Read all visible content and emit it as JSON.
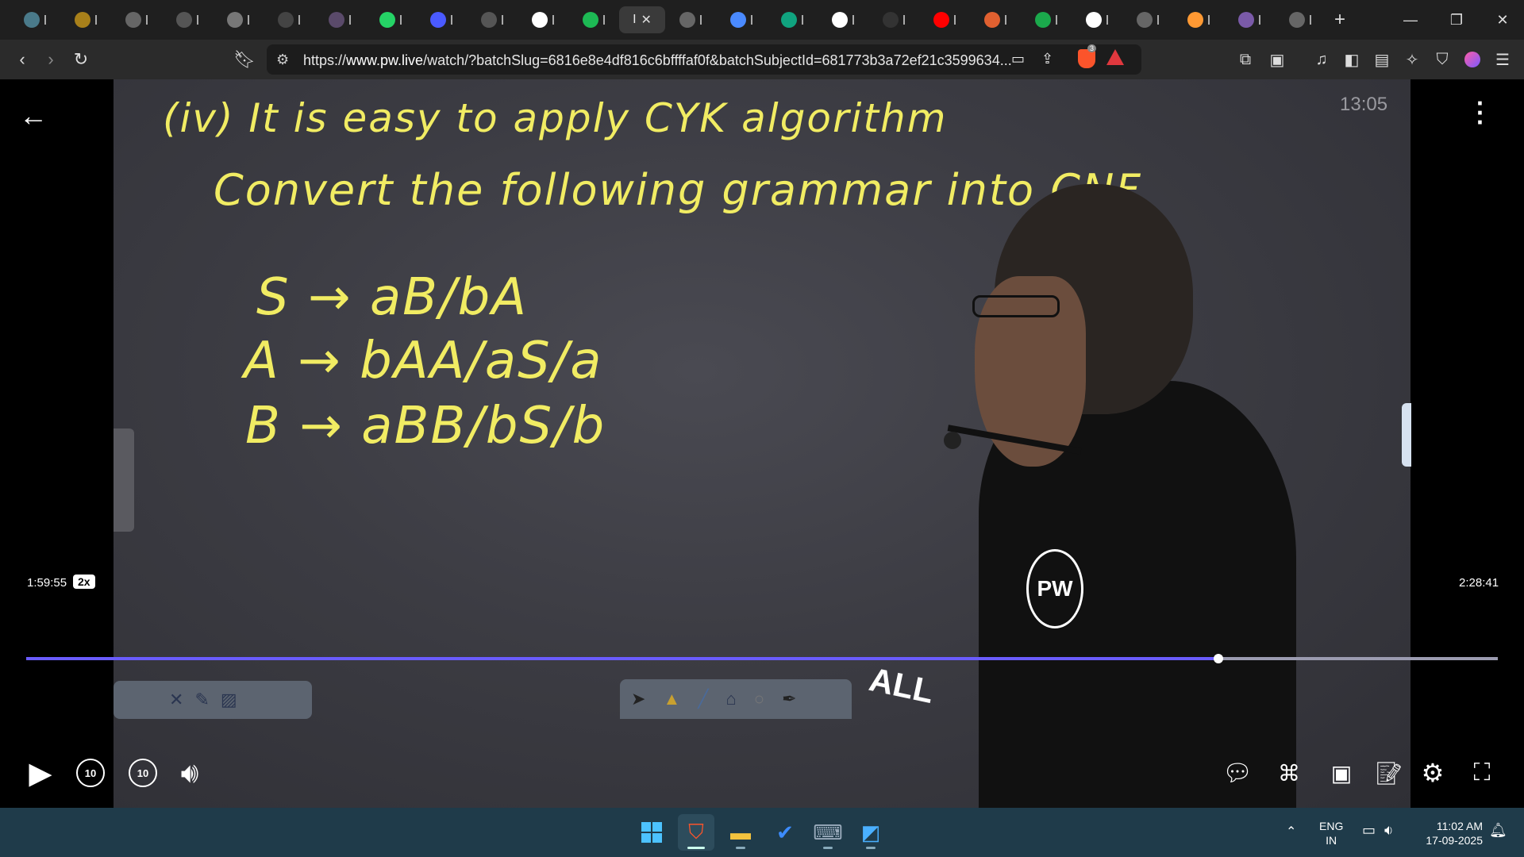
{
  "browser": {
    "tabs": [
      {
        "icon": "chat-icon",
        "color": "#4a7a8a"
      },
      {
        "icon": "coin-icon",
        "color": "#a8801a"
      },
      {
        "icon": "globe-icon",
        "color": "#666"
      },
      {
        "icon": "gpt-icon",
        "color": "#555"
      },
      {
        "icon": "w3-icon",
        "color": "#777"
      },
      {
        "icon": "aoe-icon",
        "color": "#444"
      },
      {
        "icon": "portrait-icon",
        "color": "#5a4a6a"
      },
      {
        "icon": "whatsapp-icon",
        "color": "#25d366"
      },
      {
        "icon": "bookmark-icon",
        "color": "#4a5aff"
      },
      {
        "icon": "ortip-icon",
        "color": "#555"
      },
      {
        "icon": "google-icon",
        "color": "#ffffff"
      },
      {
        "icon": "spotify-icon",
        "color": "#1db954"
      },
      {
        "icon": "globe-icon",
        "color": "#666"
      },
      {
        "icon": "gemini-icon",
        "color": "#4a8aff"
      },
      {
        "icon": "openai-icon",
        "color": "#10a37f"
      },
      {
        "icon": "google-icon",
        "color": "#ffffff"
      },
      {
        "icon": "screen-icon",
        "color": "#333"
      },
      {
        "icon": "youtube-icon",
        "color": "#ff0000"
      },
      {
        "icon": "sphere-icon",
        "color": "#e06030"
      },
      {
        "icon": "hackerrank-icon",
        "color": "#1ba94c"
      },
      {
        "icon": "wikipedia-icon",
        "color": "#ffffff"
      },
      {
        "icon": "globe-icon",
        "color": "#666"
      },
      {
        "icon": "india-flag-icon",
        "color": "#ff9933"
      },
      {
        "icon": "badge-icon",
        "color": "#7a5aa8"
      },
      {
        "icon": "globe-icon",
        "color": "#666"
      }
    ],
    "active_tab_label": "I",
    "new_tab": "+",
    "url_prefix": "https://",
    "url_host": "www.pw.live",
    "url_rest": "/watch/?batchSlug=6816e8e4df816c6bffffaf0f&batchSubjectId=681773b3a72ef21c3599634...",
    "brave_badge": "3"
  },
  "video": {
    "clock": "13:05",
    "elapsed": "1:59:55",
    "speed": "2x",
    "duration": "2:28:41",
    "progress_fraction": 0.81,
    "skip_back": "10",
    "skip_forward": "10",
    "board_lines": [
      "(iv) It is easy to apply CYK algorithm",
      "Convert the following grammar into CNF"
    ],
    "grammar": [
      "S → aB/bA",
      "A → bAA/aS/a",
      "B → aBB/bS/b"
    ],
    "shirt_logo": "PW",
    "shirt_text": "ALL"
  },
  "taskbar": {
    "lang_top": "ENG",
    "lang_bottom": "IN",
    "time": "11:02 AM",
    "date": "17-09-2025"
  }
}
